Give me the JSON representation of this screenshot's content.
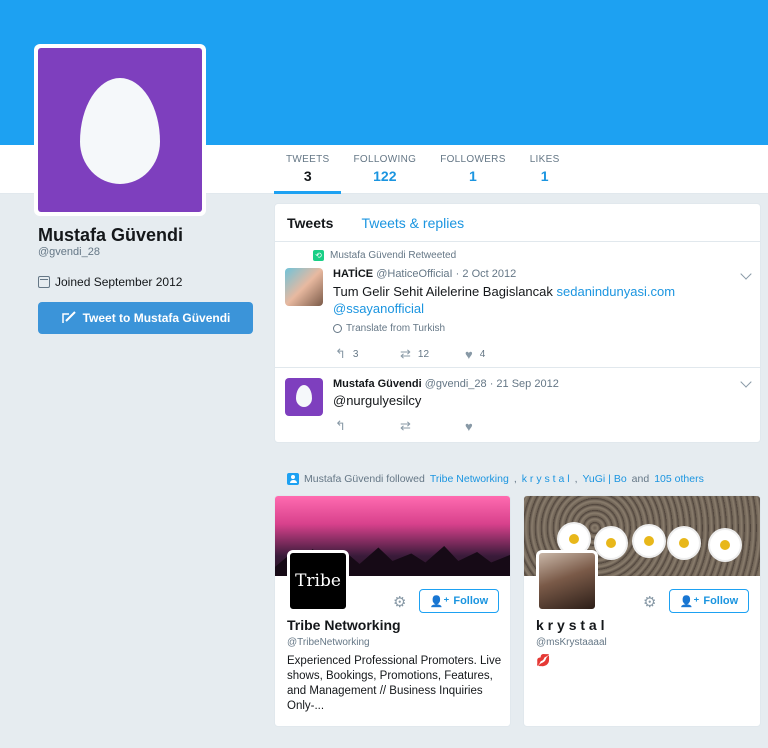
{
  "colors": {
    "brand": "#1da1f2",
    "link": "#1b95e0",
    "avatar_bg": "#7e3fbe",
    "retweet": "#19cf86"
  },
  "profile": {
    "name": "Mustafa Güvendi",
    "handle": "@gvendi_28",
    "joined": "Joined September 2012",
    "tweet_to_label": "Tweet to Mustafa Güvendi"
  },
  "stats": [
    {
      "label": "TWEETS",
      "value": "3"
    },
    {
      "label": "FOLLOWING",
      "value": "122"
    },
    {
      "label": "FOLLOWERS",
      "value": "1"
    },
    {
      "label": "LIKES",
      "value": "1"
    }
  ],
  "timeline": {
    "tabs": [
      "Tweets",
      "Tweets & replies"
    ],
    "tweets": [
      {
        "retweet_context": "Mustafa Güvendi Retweeted",
        "author_name": "HATİCE",
        "author_handle": "@HaticeOfficiaI",
        "date": "2 Oct 2012",
        "text_prefix": "Tum Gelir Sehit Ailelerine Bagislancak ",
        "link1": "sedanindunyasi.com",
        "link2": "@ssayanofficial",
        "translate": "Translate from Turkish",
        "replies": "3",
        "retweets": "12",
        "likes": "4"
      },
      {
        "author_name": "Mustafa Güvendi",
        "author_handle": "@gvendi_28",
        "date": "21 Sep 2012",
        "text": "@nurgulyesilcy"
      }
    ]
  },
  "followed": {
    "prefix": "Mustafa Güvendi followed",
    "link1": "Tribe Networking",
    "link2": "k r y s t a l",
    "link3": "YuGi | Bo",
    "and": "and",
    "others": "105 others"
  },
  "cards": [
    {
      "name": "Tribe Networking",
      "handle": "@TribeNetworking",
      "avatar_text": "Tribe",
      "bio": "Experienced Professional Promoters. Live shows, Bookings, Promotions, Features, and Management // Business Inquiries Only-...",
      "follow_label": "Follow"
    },
    {
      "name": "k r y s t a l",
      "handle": "@msKrystaaaal",
      "bio": "💋",
      "follow_label": "Follow"
    }
  ]
}
